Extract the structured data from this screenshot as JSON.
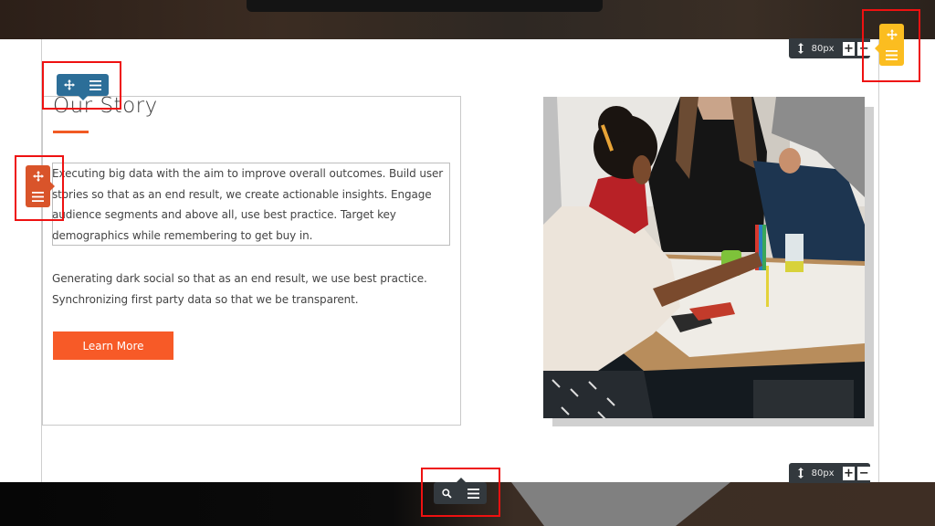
{
  "section": {
    "title": "Our Story",
    "paragraph_1": "Executing big data with the aim to improve overall outcomes. Build user stories so that as an end result, we create actionable insights. Engage audience segments and above all, use best practice. Target key demographics while remembering to get buy in.",
    "paragraph_2": "Generating dark social so that as an end result, we use best practice. Synchronizing first party data so that we be transparent.",
    "button_label": "Learn More",
    "image_alt": "Group of students collaborating around a table with markers and paper"
  },
  "editor": {
    "top_spacing": {
      "value": "80px",
      "increase_label": "+",
      "decrease_label": "−"
    },
    "bottom_spacing": {
      "value": "80px",
      "increase_label": "+",
      "decrease_label": "−"
    },
    "toolbars": {
      "heading": {
        "color": "#2c6e98",
        "icons": [
          "move-icon",
          "menu-icon"
        ]
      },
      "text_block": {
        "color": "#d9542a",
        "icons": [
          "move-icon",
          "menu-icon"
        ]
      },
      "section": {
        "color": "#fbbd20",
        "icons": [
          "move-icon",
          "menu-icon"
        ]
      },
      "row": {
        "color": "#33393e",
        "icons": [
          "zoom-icon",
          "menu-icon"
        ]
      }
    },
    "highlight_color": "#ee1111"
  },
  "colors": {
    "accent": "#f75a27",
    "text": "#444444"
  }
}
